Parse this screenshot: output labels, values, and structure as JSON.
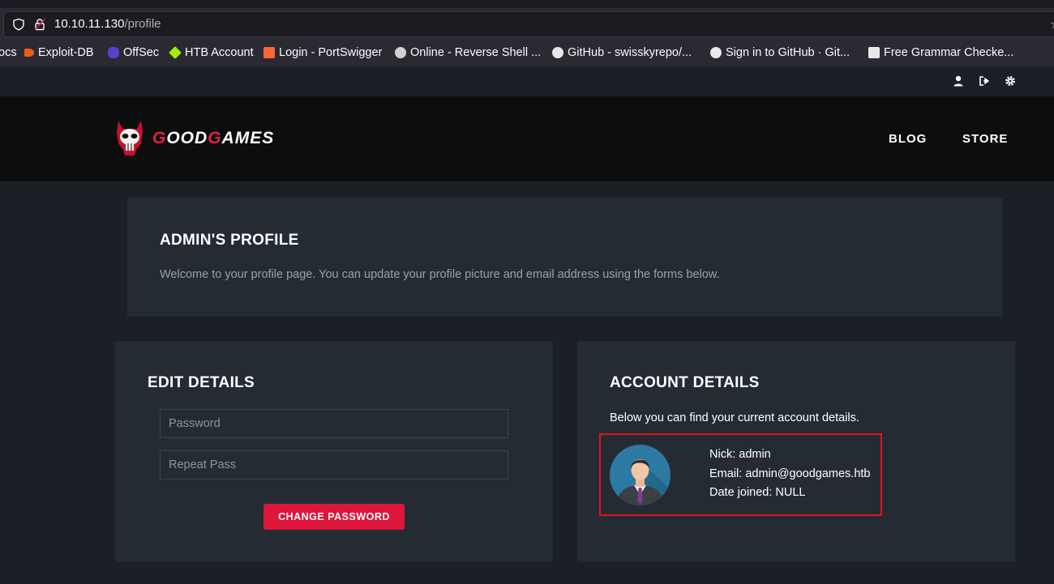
{
  "browser": {
    "url_host": "10.10.11.130",
    "url_path": "/profile",
    "bookmarks": [
      {
        "label": "ocs",
        "icon": "none"
      },
      {
        "label": "Exploit-DB",
        "icon": "exploitdb-icon"
      },
      {
        "label": "OffSec",
        "icon": "offsec-icon"
      },
      {
        "label": "HTB Account",
        "icon": "htb-icon"
      },
      {
        "label": "Login - PortSwigger",
        "icon": "portswigger-icon"
      },
      {
        "label": "Online - Reverse Shell ...",
        "icon": "skull-icon"
      },
      {
        "label": "GitHub - swisskyrepo/...",
        "icon": "github-icon"
      },
      {
        "label": "Sign in to GitHub · Git...",
        "icon": "github-icon"
      },
      {
        "label": "Free Grammar Checke...",
        "icon": "grammar-icon"
      }
    ]
  },
  "topbar": {
    "icons": [
      "user-icon",
      "logout-icon",
      "settings-icon"
    ]
  },
  "header": {
    "logo_letters": [
      "G",
      "OOD",
      "G",
      "AMES"
    ],
    "nav": [
      "BLOG",
      "STORE"
    ]
  },
  "profile": {
    "title": "ADMIN'S PROFILE",
    "subtitle": "Welcome to your profile page. You can update your profile picture and email address using the forms below."
  },
  "edit": {
    "title": "EDIT DETAILS",
    "password_placeholder": "Password",
    "repeat_placeholder": "Repeat Pass",
    "button": "CHANGE PASSWORD"
  },
  "account": {
    "title": "ACCOUNT DETAILS",
    "intro": "Below you can find your current account details.",
    "nick": "Nick: admin",
    "email": "Email: admin@goodgames.htb",
    "joined": "Date joined: NULL"
  },
  "colors": {
    "accent": "#dd163b",
    "page_bg": "#1b2026",
    "panel_bg": "#252b33",
    "header_bg": "#0c0d0f",
    "highlight": "#e3131f"
  }
}
